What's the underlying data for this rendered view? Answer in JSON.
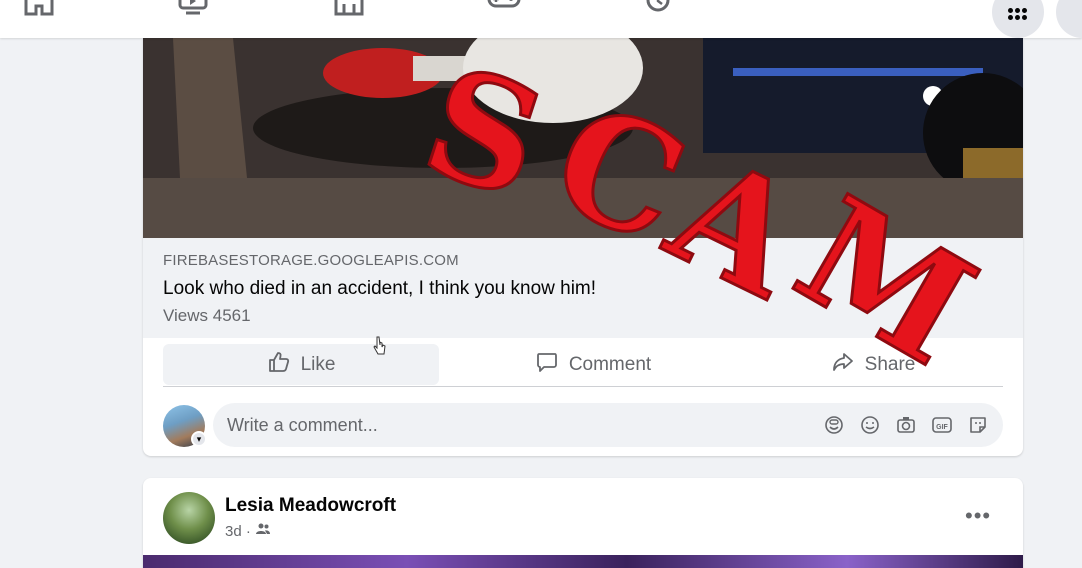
{
  "nav": {
    "icons": [
      "home-icon",
      "watch-icon",
      "marketplace-icon",
      "gaming-icon",
      "memories-icon",
      "menu-icon",
      "messenger-icon"
    ]
  },
  "post": {
    "link_domain": "FIREBASESTORAGE.GOOGLEAPIS.COM",
    "link_title": "Look who died in an accident, I think you know him!",
    "views_text": "Views 4561",
    "actions": {
      "like": "Like",
      "comment": "Comment",
      "share": "Share"
    },
    "comment_placeholder": "Write a comment...",
    "comment_icons": [
      "avatar-sticker-icon",
      "emoji-icon",
      "camera-icon",
      "gif-icon",
      "sticker-icon"
    ]
  },
  "overlay": {
    "text": "SCAM",
    "letters": [
      "S",
      "C",
      "A",
      "M"
    ],
    "color": "#e5141c"
  },
  "post2": {
    "author": "Lesia Meadowcroft",
    "time": "3d ·",
    "audience_icon": "friends-icon",
    "more": "•••"
  },
  "colors": {
    "background": "#f0f2f5",
    "card": "#ffffff",
    "secondary_text": "#65676b",
    "primary_text": "#050505"
  }
}
